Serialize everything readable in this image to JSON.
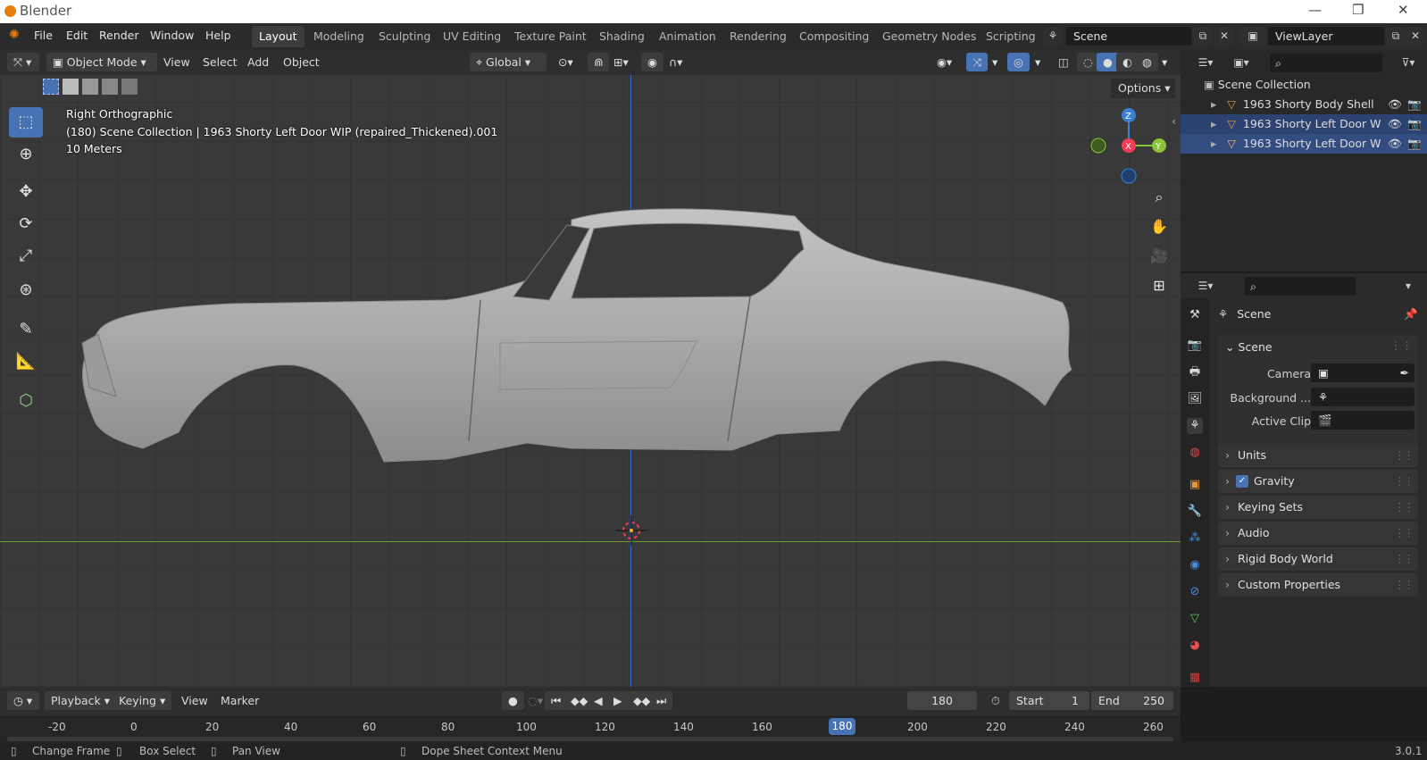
{
  "app": {
    "title": "Blender",
    "version": "3.0.1"
  },
  "menu": {
    "items": [
      "File",
      "Edit",
      "Render",
      "Window",
      "Help"
    ]
  },
  "workspaces": [
    {
      "label": "Layout",
      "active": true
    },
    {
      "label": "Modeling",
      "active": false
    },
    {
      "label": "Sculpting",
      "active": false
    },
    {
      "label": "UV Editing",
      "active": false
    },
    {
      "label": "Texture Paint",
      "active": false
    },
    {
      "label": "Shading",
      "active": false
    },
    {
      "label": "Animation",
      "active": false
    },
    {
      "label": "Rendering",
      "active": false
    },
    {
      "label": "Compositing",
      "active": false
    },
    {
      "label": "Geometry Nodes",
      "active": false
    },
    {
      "label": "Scripting",
      "active": false
    }
  ],
  "scene_field": {
    "value": "Scene"
  },
  "viewlayer_field": {
    "value": "ViewLayer"
  },
  "viewport_header": {
    "mode": "Object Mode",
    "menus": [
      "View",
      "Select",
      "Add",
      "Object"
    ],
    "transform_orientation": "Global",
    "options_label": "Options"
  },
  "viewport": {
    "view_name": "Right Orthographic",
    "collection_info": "(180) Scene Collection | 1963 Shorty Left Door WIP (repaired_Thickened).001",
    "scale": "10 Meters",
    "gizmo": {
      "z": "Z",
      "x": "X",
      "y": "Y"
    }
  },
  "outliner": {
    "root": "Scene Collection",
    "items": [
      {
        "label": "1963 Shorty Body Shell"
      },
      {
        "label": "1963 Shorty Left Door W"
      },
      {
        "label": "1963 Shorty Left Door W"
      }
    ]
  },
  "properties": {
    "context": "Scene",
    "section": "Scene",
    "fields": {
      "camera": "Camera",
      "background": "Background ...",
      "active_clip": "Active Clip"
    },
    "panels": [
      "Units",
      "Gravity",
      "Keying Sets",
      "Audio",
      "Rigid Body World",
      "Custom Properties"
    ],
    "gravity_checked": true
  },
  "timeline": {
    "menus": [
      "Playback",
      "Keying",
      "View",
      "Marker"
    ],
    "current_frame": "180",
    "start_label": "Start",
    "start": "1",
    "end_label": "End",
    "end": "250",
    "ruler_ticks": [
      "-20",
      "0",
      "20",
      "40",
      "60",
      "80",
      "100",
      "120",
      "140",
      "160",
      "180",
      "200",
      "220",
      "240",
      "260"
    ],
    "playhead": "180"
  },
  "status_bar": {
    "items": [
      "Change Frame",
      "Box Select",
      "Pan View",
      "Dope Sheet Context Menu"
    ]
  },
  "colors": {
    "accent": "#4772b3",
    "x_axis": "#f23c55",
    "y_axis": "#8bc43a",
    "z_axis": "#3d7ed6",
    "header": "#2e2e2e"
  }
}
